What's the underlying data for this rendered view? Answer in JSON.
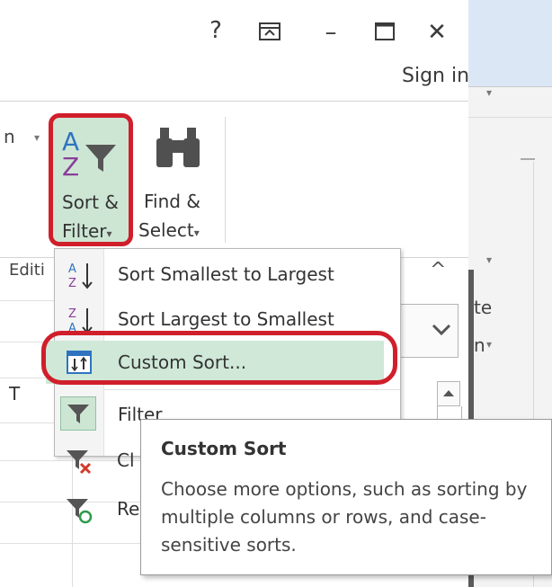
{
  "window": {
    "help_label": "?",
    "ribbon_display_label": "⊼",
    "minimize_label": "–",
    "maximize_label": "☐",
    "close_label": "✕",
    "sign_in_label": "Sign in"
  },
  "ribbon": {
    "partial_left_text": "n",
    "sort_filter": {
      "line1": "Sort &",
      "line2": "Filter",
      "arrow": "▾"
    },
    "find_select": {
      "line1": "Find &",
      "line2": "Select",
      "arrow": "▾"
    },
    "group_label": "Editi",
    "collapse_label": "^"
  },
  "menu": {
    "items": [
      {
        "label": "Sort Smallest to Largest",
        "icon": "sort-ascending-icon"
      },
      {
        "label": "Sort Largest to Smallest",
        "icon": "sort-descending-icon"
      },
      {
        "label": "Custom Sort...",
        "icon": "custom-sort-icon"
      },
      {
        "label": "Filter",
        "icon": "filter-icon"
      },
      {
        "label": "Cl",
        "icon": "clear-filter-icon"
      },
      {
        "label": "Re",
        "icon": "reapply-filter-icon"
      }
    ]
  },
  "tooltip": {
    "title": "Custom Sort",
    "body": "Choose more options, such as sorting by multiple columns or rows, and case-sensitive sorts."
  },
  "background": {
    "cell_text": "T",
    "partial_text_1": "te",
    "partial_text_2": "n"
  },
  "colors": {
    "highlight_green": "#cde6d4",
    "annotation_red": "#d01f2b",
    "ribbon_blue": "#dbe7f5"
  }
}
